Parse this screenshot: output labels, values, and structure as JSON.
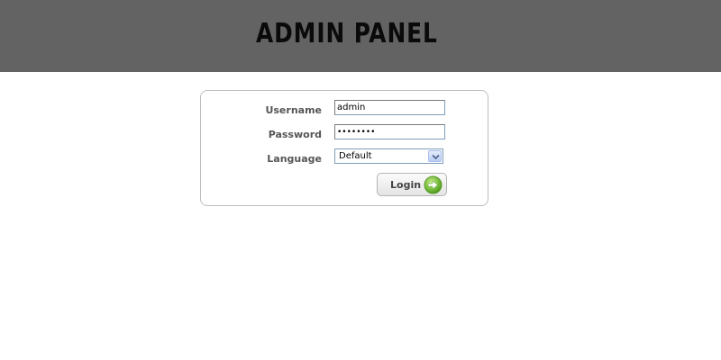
{
  "header": {
    "title": "ADMIN PANEL"
  },
  "login_form": {
    "username_label": "Username",
    "username_value": "admin",
    "password_label": "Password",
    "password_value": "••••••••",
    "language_label": "Language",
    "language_selected": "Default",
    "login_button_label": "Login",
    "login_icon": "arrow-right-circle-icon",
    "select_icon": "chevron-down-icon"
  },
  "colors": {
    "header_bg": "#636363",
    "login_icon_green": "#7dc142"
  }
}
